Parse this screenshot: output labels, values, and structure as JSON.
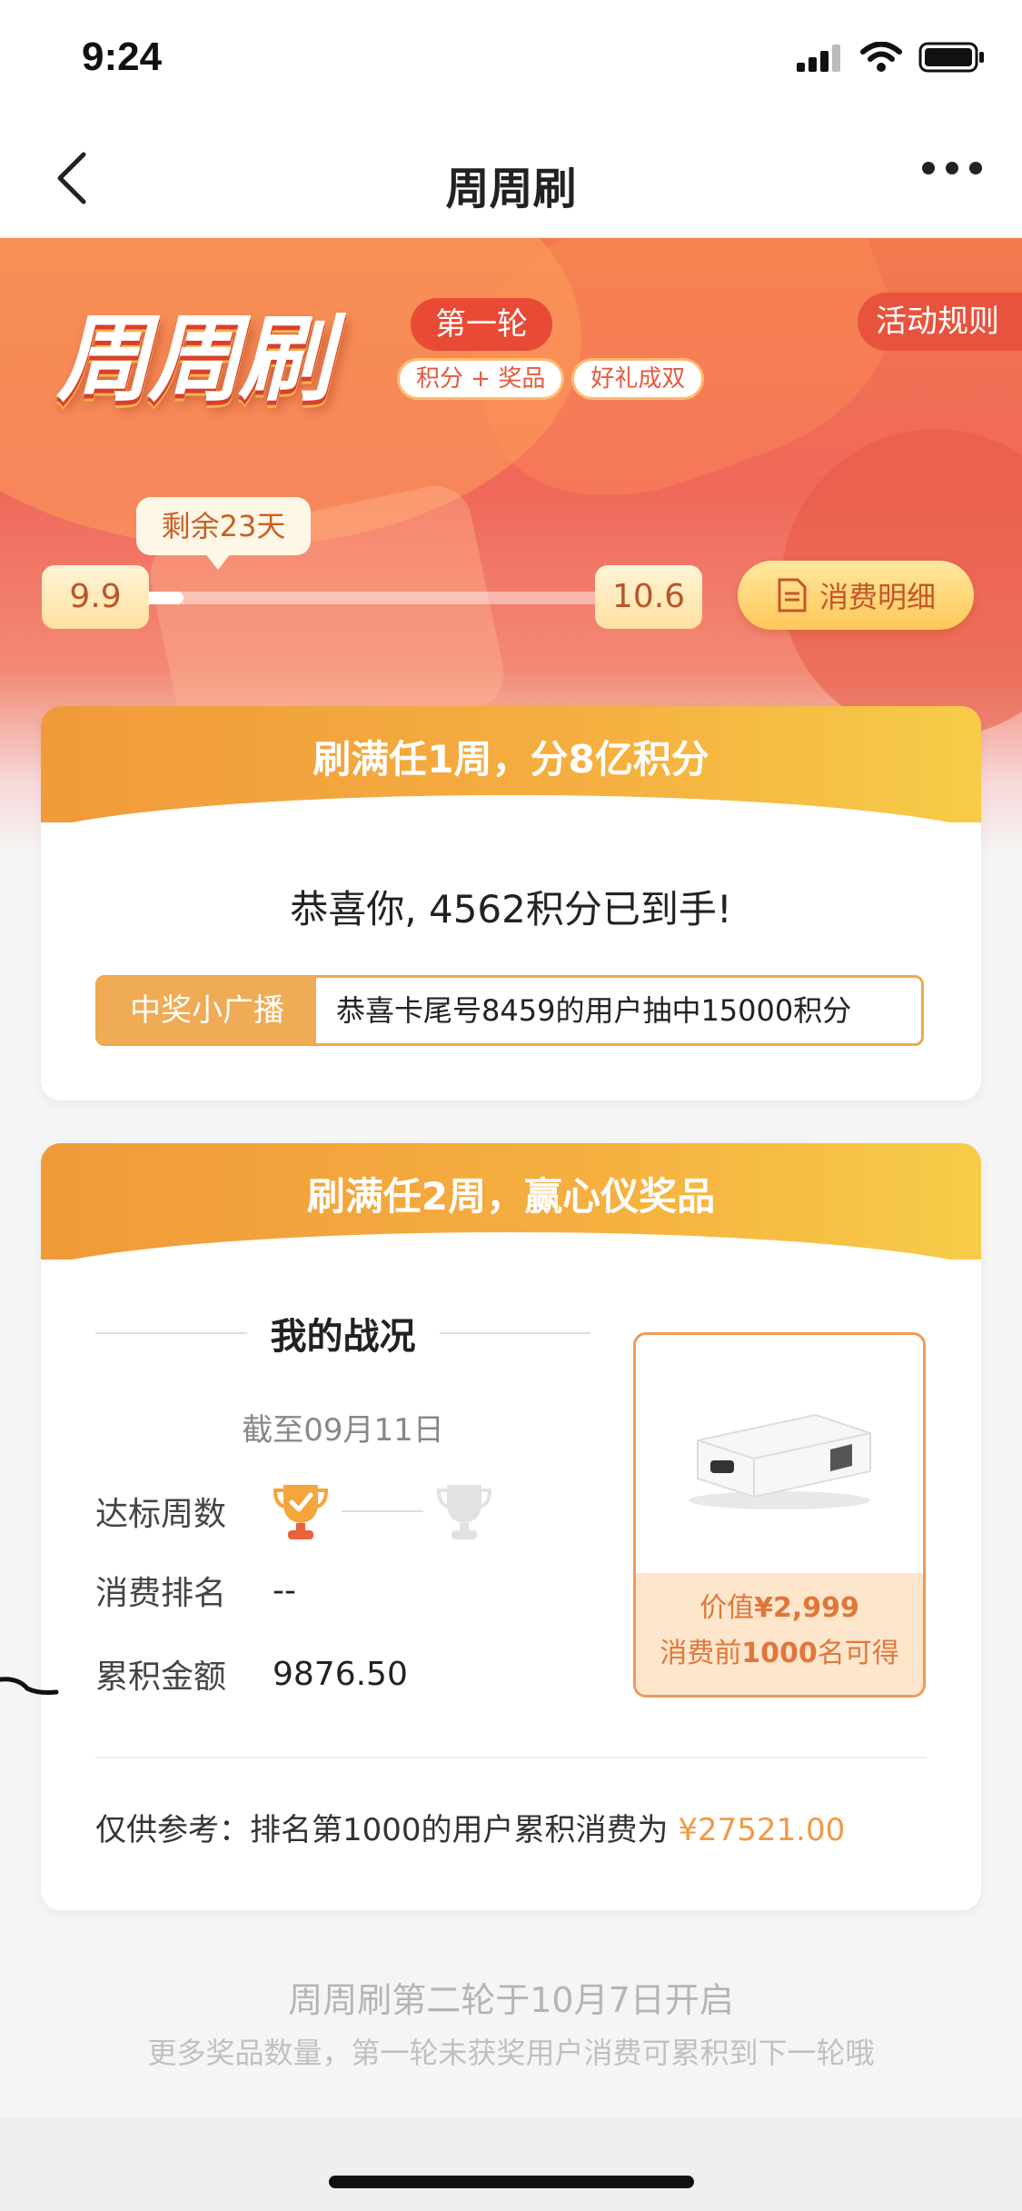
{
  "status_bar": {
    "time": "9:24"
  },
  "nav": {
    "title": "周周刷"
  },
  "hero": {
    "logo_text": "周周刷",
    "round": "第一轮",
    "tags": [
      "积分 + 奖品",
      "好礼成双"
    ],
    "rules_button": "活动规则",
    "remaining": "剩余23天",
    "start_date": "9.9",
    "end_date": "10.6",
    "progress_fraction": 0.1,
    "detail_button": "消费明细"
  },
  "card1": {
    "title": "刷满任1周，分8亿积分",
    "congrats": "恭喜你, 4562积分已到手!",
    "broadcast_label": "中奖小广播",
    "broadcast_text": "恭喜卡尾号8459的用户抽中15000积分"
  },
  "card2": {
    "title": "刷满任2周，赢心仪奖品",
    "section_title": "我的战况",
    "as_of": "截至09月11日",
    "weeks_label": "达标周数",
    "weeks_achieved": 1,
    "weeks_total": 2,
    "rank_label": "消费排名",
    "rank_value": "--",
    "total_label": "累积金额",
    "total_value": "9876.50",
    "prize_value_prefix": "价值",
    "prize_value": "¥2,999",
    "prize_cond_prefix": "消费前",
    "prize_cond_num": "1000",
    "prize_cond_suffix": "名可得",
    "ref_text": "仅供参考：排名第1000的用户累积消费为",
    "ref_amount": "¥27521.00"
  },
  "footer": {
    "line1": "周周刷第二轮于10月7日开启",
    "line2": "更多奖品数量，第一轮未获奖用户消费可累积到下一轮哦"
  },
  "colors": {
    "accent": "#f09a45",
    "hero": "#f0685a",
    "badge": "#e84a35"
  }
}
